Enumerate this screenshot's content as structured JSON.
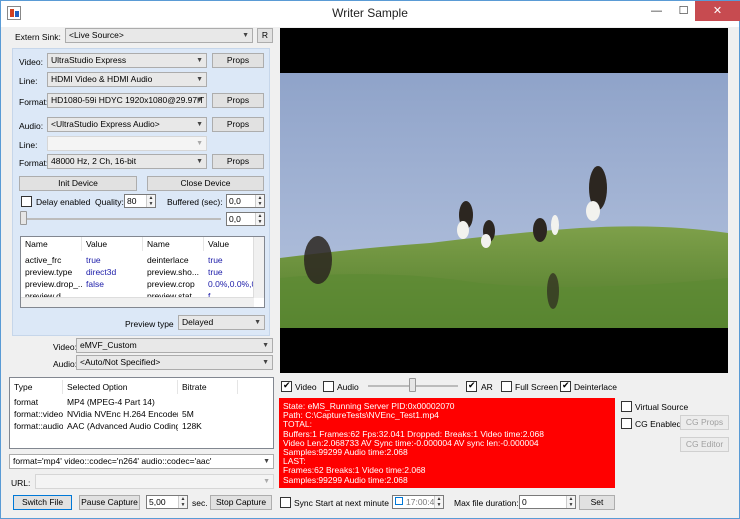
{
  "window": {
    "title": "Writer Sample",
    "minimize": "—",
    "maximize": "☐",
    "close": "✕"
  },
  "left": {
    "extern_sink_label": "Extern Sink:",
    "extern_sink_value": "<Live Source>",
    "extern_sink_button": "R",
    "video_label": "Video:",
    "video_value": "UltraStudio Express",
    "props": "Props",
    "line_label": "Line:",
    "line_value": "HDMI Video & HDMI Audio",
    "format_label": "Format:",
    "format_value": "HD1080-59i HDYC 1920x1080@29.97iT",
    "audio_label": "Audio:",
    "audio_value": "<UltraStudio Express Audio>",
    "audio_line_label": "Line:",
    "audio_line_value": "",
    "audio_format_label": "Format:",
    "audio_format_value": "48000 Hz, 2 Ch, 16-bit",
    "init_device": "Init Device",
    "close_device": "Close Device",
    "delay_enabled": "Delay enabled",
    "quality_label": "Quality:",
    "quality_value": "80",
    "buffered_label": "Buffered (sec):",
    "buffered_value": "0,0",
    "slider_value": "0,0",
    "props_grid": {
      "headers": [
        "Name",
        "Value",
        "Name",
        "Value"
      ],
      "rows": [
        [
          "active_frc",
          "true",
          "deinterlace",
          "true"
        ],
        [
          "preview.type",
          "direct3d",
          "preview.sho...",
          "true"
        ],
        [
          "preview.drop_...",
          "false",
          "preview.crop",
          "0.0%,0.0%,0..."
        ],
        [
          "preview.d...",
          "",
          "preview.stat...",
          "f..."
        ]
      ]
    },
    "preview_type_label": "Preview type",
    "preview_type_value": "Delayed",
    "enc_video_label": "Video:",
    "enc_video_value": "eMVF_Custom",
    "enc_audio_label": "Audio:",
    "enc_audio_value": "<Auto/Not Specified>",
    "enc_grid": {
      "headers": [
        "Type",
        "Selected Option",
        "Bitrate"
      ],
      "rows": [
        [
          "format",
          "MP4 (MPEG-4 Part 14)",
          ""
        ],
        [
          "format::video",
          "NVidia NVEnc H.264 Encoder",
          "5M"
        ],
        [
          "format::audio",
          "AAC (Advanced Audio Coding)",
          "128K"
        ]
      ]
    },
    "format_string": "format='mp4' video::codec='n264' audio::codec='aac'",
    "url_label": "URL:",
    "url_value": "",
    "switch_file": "Switch File",
    "pause_capture": "Pause Capture",
    "seconds_value": "5,00",
    "sec_label": "sec.",
    "stop_capture": "Stop Capture"
  },
  "right": {
    "video_check": "Video",
    "audio_check": "Audio",
    "ar_check": "AR",
    "fullscreen_check": "Full Screen",
    "deinterlace_check": "Deinterlace",
    "status_lines": [
      "State: eMS_Running Server PID:0x00002070",
      "Path: C:\\CaptureTests\\NVEnc_Test1.mp4",
      "TOTAL:",
      "  Buffers:1 Frames:62 Fps:32.041 Dropped: Breaks:1  Video time:2.068",
      "Video Len:2.068733 AV Sync time:-0.000004 AV sync len:-0.000004",
      "  Samples:99299 Audio time:2.068",
      "LAST:",
      "  Frames:62 Breaks:1 Video time:2.068",
      "  Samples:99299 Audio time:2.068"
    ],
    "virtual_source": "Virtual Source",
    "cg_enabled": "CG Enabled",
    "cg_props": "CG Props",
    "cg_editor": "CG Editor",
    "sync_start": "Sync Start at next minute",
    "time_value": "17:00:4",
    "max_duration_label": "Max file duration:",
    "max_duration_value": "0",
    "set_button": "Set"
  }
}
